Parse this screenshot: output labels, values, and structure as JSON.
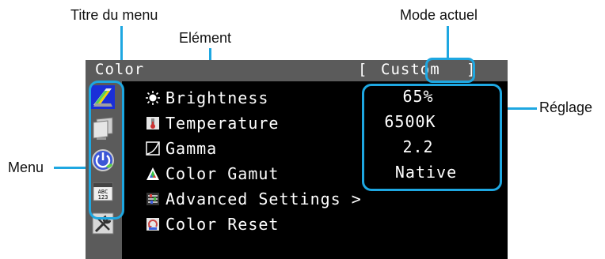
{
  "annotations": {
    "menu_title": "Titre du menu",
    "current_mode": "Mode actuel",
    "element": "Elément",
    "setting": "Réglage",
    "menu": "Menu"
  },
  "osd": {
    "title": "Color",
    "mode_open": "[",
    "mode_value": "Custom",
    "mode_close": "]",
    "sidebar_icons": [
      "color-icon",
      "screen-icon",
      "power-eco-icon",
      "language-icon",
      "tools-icon"
    ],
    "items": [
      {
        "icon": "brightness-icon",
        "label": "Brightness",
        "value": "65%"
      },
      {
        "icon": "temperature-icon",
        "label": "Temperature",
        "value": "6500K"
      },
      {
        "icon": "gamma-icon",
        "label": "Gamma",
        "value": "2.2"
      },
      {
        "icon": "color-gamut-icon",
        "label": "Color Gamut",
        "value": "Native"
      },
      {
        "icon": "advanced-settings-icon",
        "label": "Advanced Settings >",
        "value": ""
      },
      {
        "icon": "color-reset-icon",
        "label": "Color Reset",
        "value": ""
      }
    ]
  },
  "colors": {
    "accent": "#1ea7e1",
    "osd_bar": "#5b5b5b",
    "osd_bg": "#000000",
    "osd_text": "#ffffff"
  }
}
